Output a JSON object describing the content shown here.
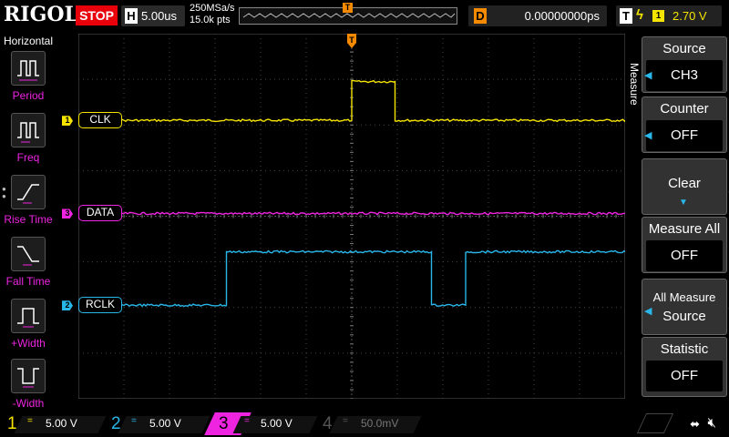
{
  "top_bar": {
    "brand": "RIGOL",
    "run_state": "STOP",
    "timebase_letter": "H",
    "timebase": "5.00us",
    "sample_rate": "250MSa/s",
    "memory_depth": "15.0k pts",
    "trigger_marker": "T",
    "delay_letter": "D",
    "delay_value": "0.00000000ps",
    "trigger_letter": "T",
    "trigger_edge_icon": "rising-edge-icon",
    "trigger_source": "1",
    "trigger_level": "2.70 V"
  },
  "left_menu": {
    "title": "Horizontal",
    "items": [
      {
        "label": "Period",
        "icon": "period-icon"
      },
      {
        "label": "Freq",
        "icon": "frequency-icon"
      },
      {
        "label": "Rise Time",
        "icon": "rise-time-icon"
      },
      {
        "label": "Fall Time",
        "icon": "fall-time-icon"
      },
      {
        "label": "+Width",
        "icon": "positive-width-icon"
      },
      {
        "label": "-Width",
        "icon": "negative-width-icon"
      }
    ]
  },
  "right_menu": {
    "tab": "Measure",
    "source": {
      "title": "Source",
      "value": "CH3"
    },
    "counter": {
      "title": "Counter",
      "value": "OFF"
    },
    "clear": {
      "title": "Clear"
    },
    "measure_all": {
      "title": "Measure All",
      "value": "OFF"
    },
    "all_measure_source": {
      "title_line1": "All Measure",
      "title_line2": "Source"
    },
    "statistic": {
      "title": "Statistic",
      "value": "OFF"
    }
  },
  "channels": [
    {
      "num": "1",
      "label": "CLK",
      "color": "#f5e400",
      "coupling": "=",
      "scale": "5.00 V"
    },
    {
      "num": "3",
      "label": "DATA",
      "color": "#ee24e1",
      "coupling": "=",
      "scale": "5.00 V"
    },
    {
      "num": "2",
      "label": "RCLK",
      "color": "#29b7ea",
      "coupling": "=",
      "scale": "5.00 V"
    }
  ],
  "bottom_bar": {
    "ch1": {
      "num": "1",
      "coupling": "=",
      "scale": "5.00 V",
      "color": "#f5e400"
    },
    "ch2": {
      "num": "2",
      "coupling": "=",
      "scale": "5.00 V",
      "color": "#29b7ea"
    },
    "ch3": {
      "num": "3",
      "coupling": "=",
      "scale": "5.00 V",
      "color": "#ee24e1"
    },
    "ch4": {
      "num": "4",
      "coupling": "=",
      "scale": "50.0mV",
      "color": "#555555"
    },
    "usb_icon": "usb-icon",
    "speaker_icon": "speaker-mute-icon"
  },
  "chart_data": {
    "type": "line",
    "xlabel": "",
    "ylabel": "",
    "x_divisions": 12,
    "y_divisions": 8,
    "x_unit": "div",
    "grid": true,
    "series": [
      {
        "name": "CLK",
        "color": "#f5e400",
        "x": [
          -6,
          0,
          0,
          0.95,
          0.95,
          6
        ],
        "y": [
          2.1,
          2.1,
          2.95,
          2.95,
          2.1,
          2.1
        ]
      },
      {
        "name": "DATA",
        "color": "#ee24e1",
        "x": [
          -6,
          6
        ],
        "y": [
          0.06,
          0.06
        ]
      },
      {
        "name": "RCLK",
        "color": "#29b7ea",
        "x": [
          -6,
          -2.75,
          -2.75,
          1.75,
          1.75,
          2.5,
          2.5,
          6
        ],
        "y": [
          -1.95,
          -1.95,
          -0.78,
          -0.78,
          -1.95,
          -1.95,
          -0.78,
          -0.78
        ]
      }
    ]
  }
}
